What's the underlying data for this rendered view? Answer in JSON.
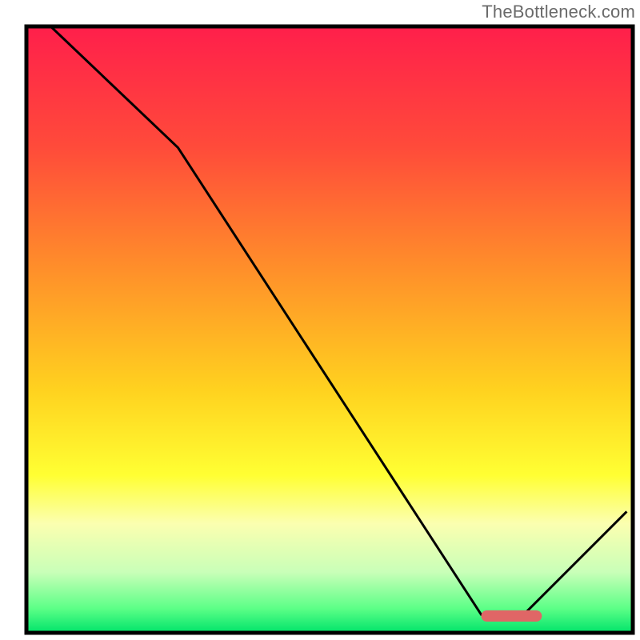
{
  "watermark": "TheBottleneck.com",
  "chart_data": {
    "type": "line",
    "title": "",
    "xlabel": "",
    "ylabel": "",
    "xlim": [
      0,
      100
    ],
    "ylim": [
      0,
      100
    ],
    "x": [
      4,
      25,
      75,
      82,
      99
    ],
    "values": [
      100,
      80,
      3,
      3,
      20
    ],
    "optimal_band_x": [
      75,
      85
    ],
    "gradient_stops": [
      {
        "offset": 0.0,
        "color": "#ff1f4b"
      },
      {
        "offset": 0.2,
        "color": "#ff4b3a"
      },
      {
        "offset": 0.4,
        "color": "#ff8f2a"
      },
      {
        "offset": 0.6,
        "color": "#ffd21f"
      },
      {
        "offset": 0.74,
        "color": "#ffff33"
      },
      {
        "offset": 0.82,
        "color": "#fbffb0"
      },
      {
        "offset": 0.9,
        "color": "#c9ffb8"
      },
      {
        "offset": 0.96,
        "color": "#5cff87"
      },
      {
        "offset": 1.0,
        "color": "#00e36a"
      }
    ],
    "marker_color": "#e06666",
    "line_color": "#000000",
    "border_color": "#000000"
  }
}
